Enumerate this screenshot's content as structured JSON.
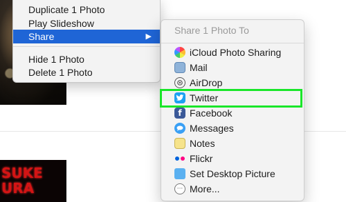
{
  "context_menu": {
    "items": [
      {
        "label": "Duplicate 1 Photo"
      },
      {
        "label": "Play Slideshow"
      },
      {
        "label": "Share",
        "submenu_arrow": "▶"
      },
      {
        "label": "Hide 1 Photo"
      },
      {
        "label": "Delete 1 Photo"
      }
    ]
  },
  "share_menu": {
    "header": "Share 1 Photo To",
    "items": [
      {
        "label": "iCloud Photo Sharing",
        "icon": "icloud-photo-sharing-icon"
      },
      {
        "label": "Mail",
        "icon": "mail-icon"
      },
      {
        "label": "AirDrop",
        "icon": "airdrop-icon"
      },
      {
        "label": "Twitter",
        "icon": "twitter-icon",
        "glyph": "🐦"
      },
      {
        "label": "Facebook",
        "icon": "facebook-icon",
        "glyph": "f"
      },
      {
        "label": "Messages",
        "icon": "messages-icon"
      },
      {
        "label": "Notes",
        "icon": "notes-icon"
      },
      {
        "label": "Flickr",
        "icon": "flickr-icon"
      },
      {
        "label": "Set Desktop Picture",
        "icon": "desktop-picture-icon"
      },
      {
        "label": "More...",
        "icon": "more-icon",
        "glyph": "···"
      }
    ]
  },
  "thumbnails": {
    "bottom_poster_text": "SUKE\nURA"
  },
  "colors": {
    "highlight": "#1f65d6",
    "focus_outline": "#19e629",
    "twitter": "#1da1f2",
    "facebook": "#3b5998"
  }
}
